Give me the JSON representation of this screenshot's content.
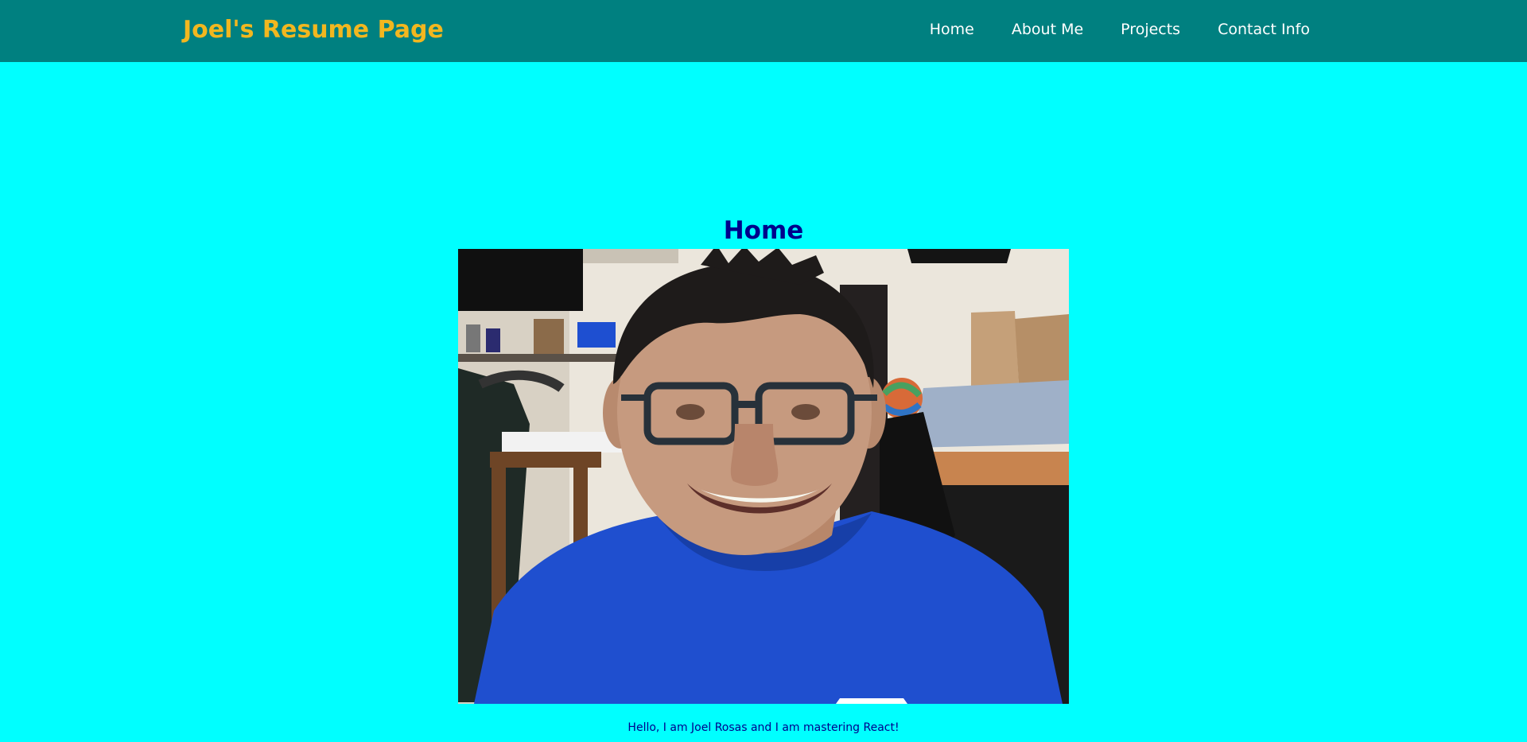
{
  "navbar": {
    "brand": "Joel's Resume Page",
    "links": [
      "Home",
      "About Me",
      "Projects",
      "Contact Info"
    ]
  },
  "main": {
    "title": "Home",
    "caption": "Hello, I am Joel Rosas and I am mastering React!"
  },
  "colors": {
    "navbar_bg": "#008080",
    "page_bg": "#00ffff",
    "brand": "#f2b71f",
    "nav_link": "#ffffff",
    "title": "#00008b"
  },
  "icons": {
    "profile_photo": "profile-photo"
  }
}
